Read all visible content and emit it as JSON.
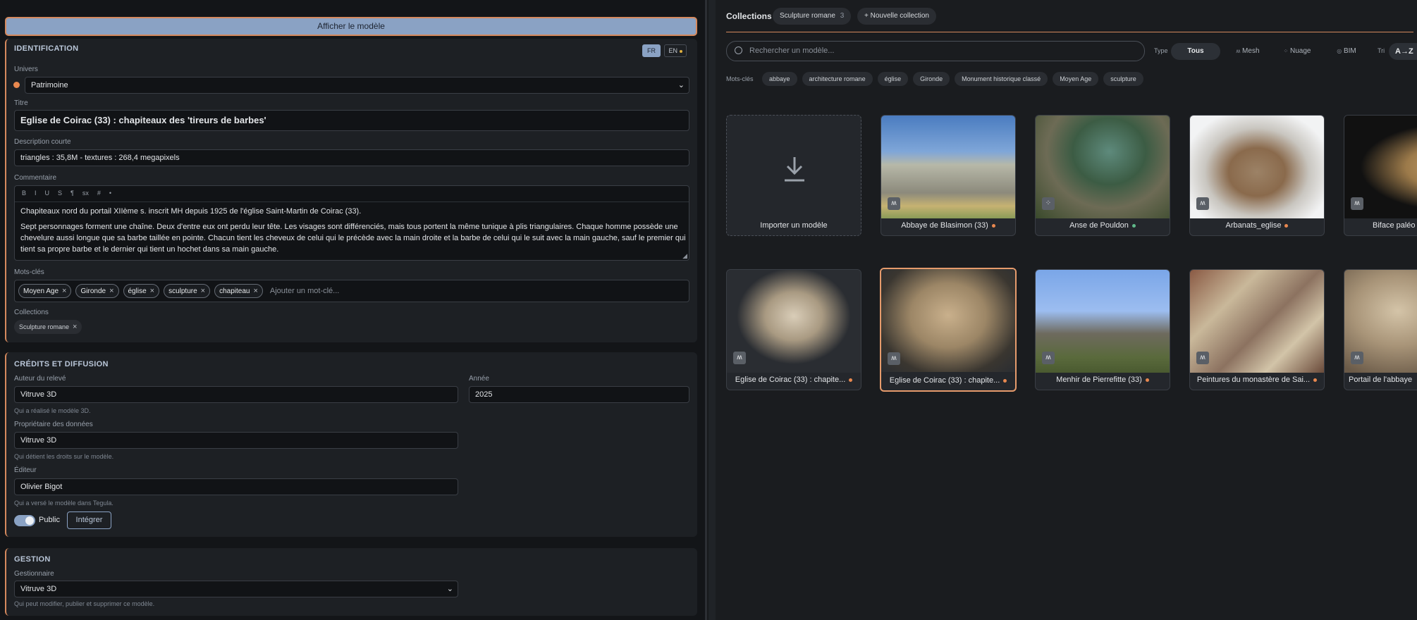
{
  "left": {
    "show_model_button": "Afficher le modèle",
    "identification": {
      "title": "IDENTIFICATION",
      "lang_fr": "FR",
      "lang_en": "EN",
      "univers_label": "Univers",
      "univers_value": "Patrimoine",
      "titre_label": "Titre",
      "titre_value": "Eglise de Coirac (33) : chapiteaux des 'tireurs de barbes'",
      "desc_label": "Description courte",
      "desc_value": "triangles : 35,8M - textures : 268,4 megapixels",
      "comment_label": "Commentaire",
      "toolbar": [
        "B",
        "I",
        "U",
        "S",
        "¶",
        "sx",
        "#",
        "•"
      ],
      "comment_lines": [
        "Chapiteaux nord du portail XIIème s. inscrit MH depuis 1925 de l'église Saint-Martin de Coirac (33).",
        "Sept personnages forment une chaîne. Deux d'entre eux ont perdu leur tête. Les visages sont différenciés, mais tous portent la même tunique à plis triangulaires. Chaque homme possède une chevelure aussi longue que sa barbe taillée en pointe. Chacun tient les cheveux de celui qui le précède avec la main droite et la barbe de celui qui le suit avec la main gauche, sauf le premier qui tient sa propre barbe et le dernier qui tient un hochet dans sa main gauche."
      ],
      "keywords_label": "Mots-clés",
      "keywords": [
        "Moyen Age",
        "Gironde",
        "église",
        "sculpture",
        "chapiteau"
      ],
      "keyword_placeholder": "Ajouter un mot-clé...",
      "collections_label": "Collections",
      "collections": [
        "Sculpture romane"
      ]
    },
    "credits": {
      "title": "CRÉDITS ET DIFFUSION",
      "author_label": "Auteur du relevé",
      "author_value": "Vitruve 3D",
      "author_help": "Qui a réalisé le modèle 3D.",
      "year_label": "Année",
      "year_value": "2025",
      "owner_label": "Propriétaire des données",
      "owner_value": "Vitruve 3D",
      "owner_help": "Qui détient les droits sur le modèle.",
      "editor_label": "Éditeur",
      "editor_value": "Olivier Bigot",
      "editor_help": "Qui a versé le modèle dans Tegula.",
      "public_label": "Public",
      "integrate_button": "Intégrer"
    },
    "gestion": {
      "title": "GESTION",
      "manager_label": "Gestionnaire",
      "manager_value": "Vitruve 3D",
      "manager_help": "Qui peut modifier, publier et supprimer ce modèle."
    }
  },
  "right": {
    "collections_title": "Collections",
    "collection_pill": "Sculpture romane",
    "collection_count": "3",
    "new_collection": "+ Nouvelle collection",
    "search_placeholder": "Rechercher un modèle...",
    "type_label": "Type",
    "types": [
      "Tous",
      "Mesh",
      "Nuage",
      "BIM"
    ],
    "sort_label": "Tri",
    "sort_value": "A→Z",
    "keywords_label": "Mots-clés",
    "keywords": [
      "abbaye",
      "architecture romane",
      "église",
      "Gironde",
      "Monument historique classé",
      "Moyen Age",
      "sculpture"
    ],
    "import_label": "Importer un modèle",
    "cards": [
      {
        "title": "Abbaye de Blasimon (33)",
        "status": "#e8884f"
      },
      {
        "title": "Anse de Pouldon",
        "status": "#5fb98a"
      },
      {
        "title": "Arbanats_eglise",
        "status": "#e8884f"
      },
      {
        "title": "Biface paléo"
      },
      {
        "title": "Eglise de Coirac (33) : chapite...",
        "status": "#e8884f"
      },
      {
        "title": "Eglise de Coirac (33) : chapite...",
        "status": "#e8884f"
      },
      {
        "title": "Menhir de Pierrefitte (33)",
        "status": "#e8884f"
      },
      {
        "title": "Peintures du monastère de Sai...",
        "status": "#e8884f"
      },
      {
        "title": "Portail de l'abbaye"
      }
    ],
    "accent": "#e69b6c"
  }
}
